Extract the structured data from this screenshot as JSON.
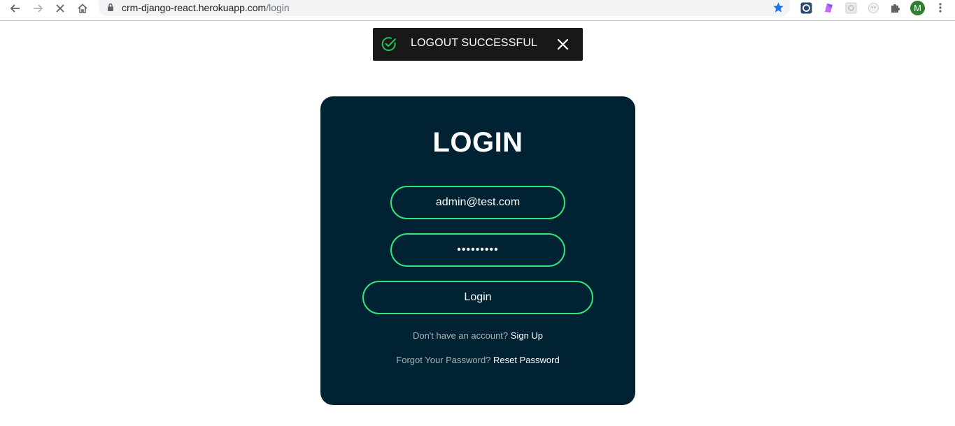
{
  "browser": {
    "url_host": "crm-django-react.herokuapp.com",
    "url_path": "/login",
    "profile_initial": "M",
    "icons": {
      "back": "arrow-left-icon",
      "forward": "arrow-right-icon",
      "stop": "close-icon",
      "home": "home-icon",
      "lock": "lock-icon",
      "bookmark": "star-icon",
      "extensions": "puzzle-icon",
      "menu": "kebab-menu-icon"
    }
  },
  "toast": {
    "message": "LOGOUT SUCCESSFUL",
    "icon": "check-circle-icon",
    "close_icon": "close-icon"
  },
  "login": {
    "title": "LOGIN",
    "email_value": "admin@test.com",
    "password_value": "•••••••••",
    "submit_label": "Login",
    "signup_prompt": "Don't have an account?",
    "signup_link": "Sign Up",
    "reset_prompt": "Forgot Your Password?",
    "reset_link": "Reset Password"
  },
  "colors": {
    "card_background": "#002233",
    "accent_border": "#2ee57a",
    "toast_background": "#181818",
    "bookmark_star": "#1a73e8"
  }
}
